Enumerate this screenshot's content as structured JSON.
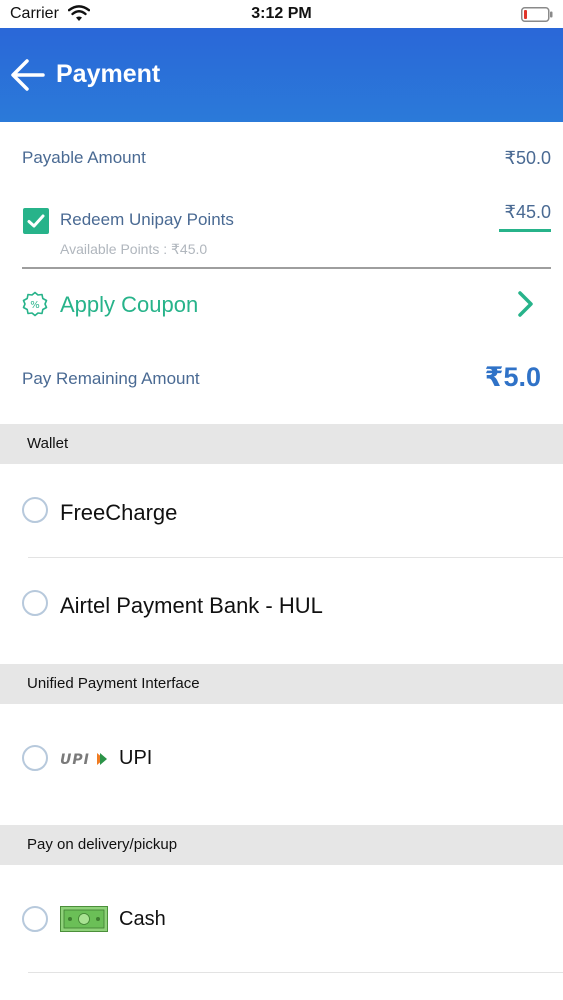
{
  "status_bar": {
    "carrier": "Carrier",
    "time": "3:12 PM",
    "icons": [
      "wifi-icon",
      "battery-icon"
    ],
    "battery_level": 0.1
  },
  "header": {
    "title": "Payment",
    "back_icon": "arrow-left-icon",
    "gradient_colors": [
      "#2a67d8",
      "#2b7ad9"
    ]
  },
  "summary": {
    "payable_label": "Payable Amount",
    "payable_value": "₹50.0",
    "redeem_label": "Redeem Unipay Points",
    "redeem_checked": true,
    "available_points": "Available Points : ₹45.0",
    "redeem_value": "₹45.0",
    "coupon_label": "Apply Coupon",
    "remaining_label": "Pay Remaining Amount",
    "remaining_value": "₹5.0"
  },
  "sections": {
    "wallet": {
      "title": "Wallet",
      "options": [
        {
          "label": "FreeCharge",
          "selected": false
        },
        {
          "label": "Airtel Payment Bank - HUL",
          "selected": false
        }
      ]
    },
    "upi": {
      "title": "Unified Payment Interface",
      "logo_text": "UPI",
      "options": [
        {
          "label": "UPI",
          "selected": false
        }
      ]
    },
    "delivery": {
      "title": "Pay on delivery/pickup",
      "options": [
        {
          "label": "Cash",
          "selected": false
        }
      ]
    }
  },
  "colors": {
    "accent_green": "#27b38a",
    "label_blue": "#4a6a93",
    "amount_blue": "#2f72c7",
    "section_bg": "#e6e6e6"
  }
}
